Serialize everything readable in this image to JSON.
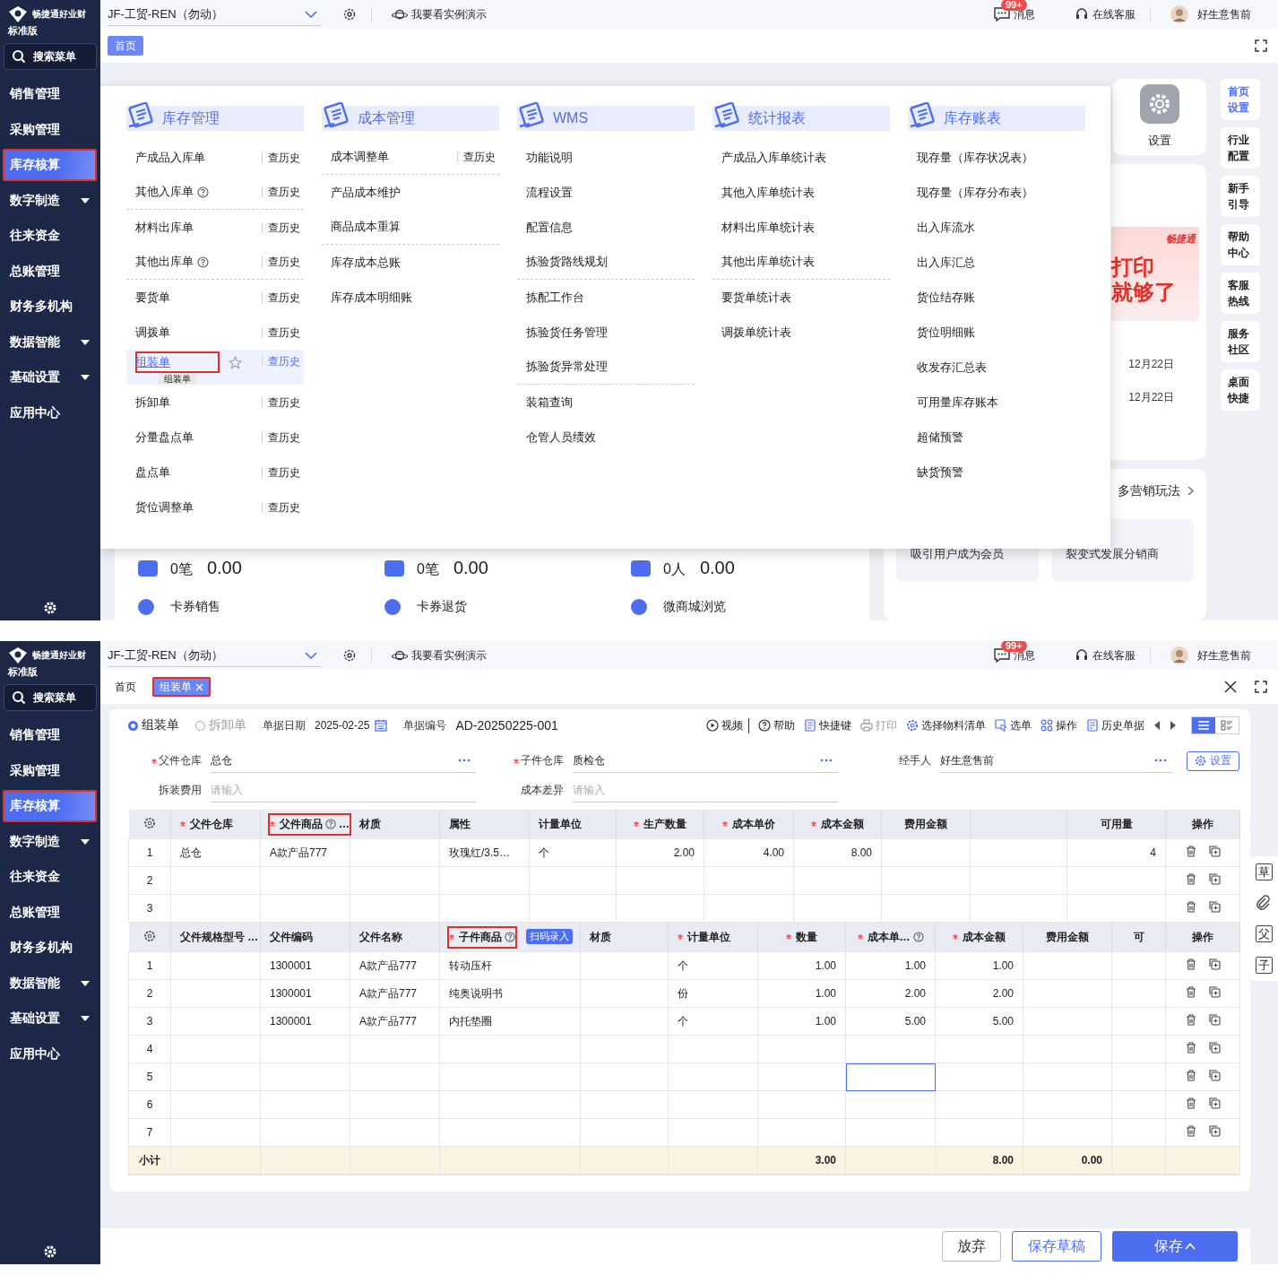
{
  "screens": [
    {
      "kind": "menu",
      "sidebar": {
        "brand": "畅捷通好业财",
        "edition": "标准版",
        "search": "搜索菜单",
        "items": [
          {
            "label": "销售管理",
            "selected": false,
            "caret": false,
            "annotated": false
          },
          {
            "label": "采购管理",
            "selected": false,
            "caret": false,
            "annotated": false
          },
          {
            "label": "库存核算",
            "selected": true,
            "caret": false,
            "annotated": true
          },
          {
            "label": "数字制造",
            "selected": false,
            "caret": true,
            "annotated": false
          },
          {
            "label": "往来资金",
            "selected": false,
            "caret": false,
            "annotated": false
          },
          {
            "label": "总账管理",
            "selected": false,
            "caret": false,
            "annotated": false
          },
          {
            "label": "财务多机构",
            "selected": false,
            "caret": false,
            "annotated": false
          },
          {
            "label": "数据智能",
            "selected": false,
            "caret": true,
            "annotated": false
          },
          {
            "label": "基础设置",
            "selected": false,
            "caret": true,
            "annotated": false
          },
          {
            "label": "应用中心",
            "selected": false,
            "caret": false,
            "annotated": false
          }
        ]
      },
      "topbar": {
        "account": "JF-工贸-REN（勿动）",
        "demo": "我要看实例演示",
        "messages": "消息",
        "badge": "99+",
        "service": "在线客服",
        "user": "好生意售前"
      },
      "tabs": [
        {
          "label": "首页",
          "selected": true,
          "closable": false,
          "annotated": false
        }
      ],
      "menu": [
        {
          "title": "库存管理",
          "items": [
            {
              "label": "产成品入库单",
              "history": "查历史",
              "help": false,
              "divider": false,
              "hovered": false,
              "annotated": false
            },
            {
              "label": "其他入库单",
              "history": "查历史",
              "help": true,
              "divider": true,
              "hovered": false,
              "annotated": false
            },
            {
              "label": "材料出库单",
              "history": "查历史",
              "help": false,
              "divider": false,
              "hovered": false,
              "annotated": false
            },
            {
              "label": "其他出库单",
              "history": "查历史",
              "help": true,
              "divider": true,
              "hovered": false,
              "annotated": false
            },
            {
              "label": "要货单",
              "history": "查历史",
              "help": false,
              "divider": false,
              "hovered": false,
              "annotated": false
            },
            {
              "label": "调拨单",
              "history": "查历史",
              "help": false,
              "divider": false,
              "hovered": false,
              "annotated": false
            },
            {
              "label": "组装单",
              "history": "查历史",
              "help": false,
              "divider": false,
              "hovered": true,
              "annotated": true,
              "tooltip": "组装单"
            },
            {
              "label": "拆卸单",
              "history": "查历史",
              "help": false,
              "divider": false,
              "hovered": false,
              "annotated": false
            },
            {
              "label": "分量盘点单",
              "history": "查历史",
              "help": false,
              "divider": false,
              "hovered": false,
              "annotated": false
            },
            {
              "label": "盘点单",
              "history": "查历史",
              "help": false,
              "divider": false,
              "hovered": false,
              "annotated": false
            },
            {
              "label": "货位调整单",
              "history": "查历史",
              "help": false,
              "divider": false,
              "hovered": false,
              "annotated": false
            }
          ]
        },
        {
          "title": "成本管理",
          "items": [
            {
              "label": "成本调整单",
              "history": "查历史",
              "help": false,
              "divider": true,
              "hovered": false,
              "annotated": false
            },
            {
              "label": "产品成本维护",
              "help": false,
              "divider": false,
              "hovered": false,
              "annotated": false
            },
            {
              "label": "商品成本重算",
              "help": false,
              "divider": true,
              "hovered": false,
              "annotated": false
            },
            {
              "label": "库存成本总账",
              "help": false,
              "divider": false,
              "hovered": false,
              "annotated": false
            },
            {
              "label": "库存成本明细账",
              "help": false,
              "divider": false,
              "hovered": false,
              "annotated": false
            }
          ]
        },
        {
          "title": "WMS",
          "items": [
            {
              "label": "功能说明",
              "help": false,
              "divider": false,
              "hovered": false,
              "annotated": false
            },
            {
              "label": "流程设置",
              "help": false,
              "divider": false,
              "hovered": false,
              "annotated": false
            },
            {
              "label": "配置信息",
              "help": false,
              "divider": false,
              "hovered": false,
              "annotated": false
            },
            {
              "label": "拣验货路线规划",
              "help": false,
              "divider": true,
              "hovered": false,
              "annotated": false
            },
            {
              "label": "拣配工作台",
              "help": false,
              "divider": false,
              "hovered": false,
              "annotated": false
            },
            {
              "label": "拣验货任务管理",
              "help": false,
              "divider": false,
              "hovered": false,
              "annotated": false
            },
            {
              "label": "拣验货异常处理",
              "help": false,
              "divider": true,
              "hovered": false,
              "annotated": false
            },
            {
              "label": "装箱查询",
              "help": false,
              "divider": false,
              "hovered": false,
              "annotated": false
            },
            {
              "label": "仓管人员绩效",
              "help": false,
              "divider": false,
              "hovered": false,
              "annotated": false
            }
          ]
        },
        {
          "title": "统计报表",
          "items": [
            {
              "label": "产成品入库单统计表",
              "help": false,
              "divider": false,
              "hovered": false,
              "annotated": false
            },
            {
              "label": "其他入库单统计表",
              "help": false,
              "divider": false,
              "hovered": false,
              "annotated": false
            },
            {
              "label": "材料出库单统计表",
              "help": false,
              "divider": false,
              "hovered": false,
              "annotated": false
            },
            {
              "label": "其他出库单统计表",
              "help": false,
              "divider": true,
              "hovered": false,
              "annotated": false
            },
            {
              "label": "要货单统计表",
              "help": false,
              "divider": false,
              "hovered": false,
              "annotated": false
            },
            {
              "label": "调拨单统计表",
              "help": false,
              "divider": false,
              "hovered": false,
              "annotated": false
            }
          ]
        },
        {
          "title": "库存账表",
          "items": [
            {
              "label": "现存量（库存状况表）",
              "help": false,
              "divider": false,
              "hovered": false,
              "annotated": false
            },
            {
              "label": "现存量（库存分布表）",
              "help": false,
              "divider": false,
              "hovered": false,
              "annotated": false
            },
            {
              "label": "出入库流水",
              "help": false,
              "divider": false,
              "hovered": false,
              "annotated": false
            },
            {
              "label": "出入库汇总",
              "help": false,
              "divider": false,
              "hovered": false,
              "annotated": false
            },
            {
              "label": "货位结存账",
              "help": false,
              "divider": false,
              "hovered": false,
              "annotated": false
            },
            {
              "label": "货位明细账",
              "help": false,
              "divider": false,
              "hovered": false,
              "annotated": false
            },
            {
              "label": "收发存汇总表",
              "help": false,
              "divider": false,
              "hovered": false,
              "annotated": false
            },
            {
              "label": "可用量库存账本",
              "help": false,
              "divider": false,
              "hovered": false,
              "annotated": false
            },
            {
              "label": "超储预警",
              "help": false,
              "divider": false,
              "hovered": false,
              "annotated": false
            },
            {
              "label": "缺货预警",
              "help": false,
              "divider": false,
              "hovered": false,
              "annotated": false
            }
          ]
        }
      ],
      "dashboard": {
        "settings": "设置",
        "banner": {
          "brand": "畅捷通",
          "lines": [
            "打印",
            "就够了"
          ]
        },
        "dates": [
          "12月22日",
          "12月22日"
        ],
        "marketing": {
          "title": "多营销玩法",
          "cards": [
            "吸引用户成为会员",
            "裂变式发展分销商"
          ]
        },
        "stats": [
          {
            "count": "0笔",
            "amount": "0.00"
          },
          {
            "count": "0笔",
            "amount": "0.00"
          },
          {
            "count": "0人",
            "amount": "0.00"
          }
        ],
        "shortcuts": [
          "卡券销售",
          "卡券退货",
          "微商城浏览"
        ]
      },
      "rail": [
        {
          "label": "首页设置",
          "selected": true
        },
        {
          "label": "行业配置",
          "selected": false
        },
        {
          "label": "新手引导",
          "selected": false
        },
        {
          "label": "帮助中心",
          "selected": false
        },
        {
          "label": "客服热线",
          "selected": false
        },
        {
          "label": "服务社区",
          "selected": false
        },
        {
          "label": "桌面快捷",
          "selected": false
        }
      ]
    },
    {
      "kind": "form",
      "sidebar": {
        "brand": "畅捷通好业财",
        "edition": "标准版",
        "search": "搜索菜单",
        "items": [
          {
            "label": "销售管理",
            "selected": false,
            "caret": false,
            "annotated": false
          },
          {
            "label": "采购管理",
            "selected": false,
            "caret": false,
            "annotated": false
          },
          {
            "label": "库存核算",
            "selected": true,
            "caret": false,
            "annotated": true
          },
          {
            "label": "数字制造",
            "selected": false,
            "caret": true,
            "annotated": false
          },
          {
            "label": "往来资金",
            "selected": false,
            "caret": false,
            "annotated": false
          },
          {
            "label": "总账管理",
            "selected": false,
            "caret": false,
            "annotated": false
          },
          {
            "label": "财务多机构",
            "selected": false,
            "caret": false,
            "annotated": false
          },
          {
            "label": "数据智能",
            "selected": false,
            "caret": true,
            "annotated": false
          },
          {
            "label": "基础设置",
            "selected": false,
            "caret": true,
            "annotated": false
          },
          {
            "label": "应用中心",
            "selected": false,
            "caret": false,
            "annotated": false
          }
        ]
      },
      "topbar": {
        "account": "JF-工贸-REN（勿动）",
        "demo": "我要看实例演示",
        "messages": "消息",
        "badge": "99+",
        "service": "在线客服",
        "user": "好生意售前"
      },
      "tabs": [
        {
          "label": "首页",
          "selected": false,
          "closable": false,
          "annotated": false
        },
        {
          "label": "组装单",
          "selected": true,
          "closable": true,
          "annotated": true
        }
      ],
      "form": {
        "modes": [
          {
            "label": "组装单",
            "selected": true
          },
          {
            "label": "拆卸单",
            "selected": false
          }
        ],
        "date_label": "单据日期",
        "date": "2025-02-25",
        "number_label": "单据编号",
        "number": "AD-20250225-001",
        "actions": [
          {
            "kind": "video",
            "label": "视频",
            "disabled": false
          },
          {
            "kind": "help",
            "label": "帮助",
            "disabled": false
          },
          {
            "kind": "shortcut",
            "label": "快捷键",
            "disabled": false
          },
          {
            "kind": "print",
            "label": "打印",
            "disabled": true
          },
          {
            "kind": "bom",
            "label": "选择物料清单",
            "disabled": false
          },
          {
            "kind": "select",
            "label": "选单",
            "disabled": false
          },
          {
            "kind": "operate",
            "label": "操作",
            "disabled": false
          },
          {
            "kind": "history",
            "label": "历史单据",
            "disabled": false
          }
        ],
        "views": [
          {
            "kind": "list",
            "selected": true
          },
          {
            "kind": "cards",
            "selected": false
          }
        ],
        "fields": [
          {
            "label": "父件仓库",
            "value": "总仓",
            "required": true,
            "picker": true
          },
          {
            "label": "子件仓库",
            "value": "质检仓",
            "required": true,
            "picker": true
          },
          {
            "label": "经手人",
            "value": "好生意售前",
            "required": false,
            "picker": true
          },
          {
            "label": "拆装费用",
            "placeholder": "请输入",
            "required": false,
            "picker": false
          },
          {
            "label": "成本差异",
            "placeholder": "请输入",
            "required": false,
            "picker": false
          }
        ],
        "settings_button": "设置"
      },
      "tables": [
        {
          "columns": [
            {
              "kind": "index"
            },
            {
              "kind": "text",
              "label": "父件仓库",
              "required": true
            },
            {
              "kind": "text",
              "label": "父件商品",
              "required": true,
              "help": true,
              "extra": "…",
              "annotated": true
            },
            {
              "kind": "text",
              "label": "材质"
            },
            {
              "kind": "text",
              "label": "属性"
            },
            {
              "kind": "text",
              "label": "计量单位"
            },
            {
              "kind": "number",
              "label": "生产数量",
              "required": true
            },
            {
              "kind": "number",
              "label": "成本单价",
              "required": true
            },
            {
              "kind": "number",
              "label": "成本金额",
              "required": true
            },
            {
              "kind": "number",
              "label": "费用金额"
            },
            {
              "kind": "number"
            },
            {
              "kind": "number",
              "label": "可用量"
            },
            {
              "kind": "ops",
              "label": "操作"
            }
          ],
          "rows": [
            {
              "cells": [
                "1",
                "总仓",
                "A款产品777",
                "",
                "玫瑰红/3.5…",
                "个",
                "2.00",
                "4.00",
                "8.00",
                "",
                "",
                "4"
              ]
            },
            {
              "cells": [
                "2",
                "",
                "",
                "",
                "",
                "",
                "",
                "",
                "",
                "",
                "",
                ""
              ]
            },
            {
              "cells": [
                "3",
                "",
                "",
                "",
                "",
                "",
                "",
                "",
                "",
                "",
                "",
                ""
              ]
            }
          ]
        },
        {
          "columns": [
            {
              "kind": "index"
            },
            {
              "kind": "text",
              "label": "父件规格型号 …"
            },
            {
              "kind": "text",
              "label": "父件编码"
            },
            {
              "kind": "text",
              "label": "父件名称"
            },
            {
              "kind": "text",
              "label": "子件商品",
              "required": true,
              "help": true,
              "annotated": true,
              "badge": "扫码录入"
            },
            {
              "kind": "text",
              "label": "材质"
            },
            {
              "kind": "text",
              "label": "计量单位",
              "required": true
            },
            {
              "kind": "number",
              "label": "数量",
              "required": true
            },
            {
              "kind": "number",
              "label": "成本单…",
              "required": true,
              "help": true
            },
            {
              "kind": "number",
              "label": "成本金额",
              "required": true
            },
            {
              "kind": "number",
              "label": "费用金额"
            },
            {
              "kind": "number",
              "label": "可"
            },
            {
              "kind": "ops",
              "label": "操作"
            }
          ],
          "rows": [
            {
              "cells": [
                "1",
                "",
                "1300001",
                "A款产品777",
                "转动压杆",
                "",
                "个",
                "1.00",
                "1.00",
                "1.00",
                "",
                ""
              ]
            },
            {
              "cells": [
                "2",
                "",
                "1300001",
                "A款产品777",
                "纯奥说明书",
                "",
                "份",
                "1.00",
                "2.00",
                "2.00",
                "",
                ""
              ]
            },
            {
              "cells": [
                "3",
                "",
                "1300001",
                "A款产品777",
                "内托垫圈",
                "",
                "个",
                "1.00",
                "5.00",
                "5.00",
                "",
                ""
              ]
            },
            {
              "cells": [
                "4",
                "",
                "",
                "",
                "",
                "",
                "",
                "",
                "",
                "",
                "",
                ""
              ]
            },
            {
              "cells": [
                "5",
                "",
                "",
                "",
                "",
                "",
                "",
                "",
                {
                  "text": "",
                  "focused": true
                },
                "",
                "",
                ""
              ]
            },
            {
              "cells": [
                "6",
                "",
                "",
                "",
                "",
                "",
                "",
                "",
                "",
                "",
                "",
                ""
              ]
            },
            {
              "cells": [
                "7",
                "",
                "",
                "",
                "",
                "",
                "",
                "",
                "",
                "",
                "",
                ""
              ]
            }
          ],
          "subtotal": {
            "cells": [
              "小计",
              "",
              "",
              "",
              "",
              "",
              "",
              "3.00",
              "",
              "8.00",
              "0.00",
              ""
            ]
          }
        }
      ],
      "side_tools": [
        {
          "kind": "glyph",
          "text": "草"
        },
        {
          "kind": "link"
        },
        {
          "kind": "glyph",
          "text": "父"
        },
        {
          "kind": "glyph",
          "text": "子"
        }
      ],
      "footer": [
        {
          "label": "放弃",
          "kind": "default",
          "caret": false
        },
        {
          "label": "保存草稿",
          "kind": "outline",
          "caret": false
        },
        {
          "label": "保存",
          "kind": "primary",
          "caret": true
        }
      ]
    }
  ]
}
